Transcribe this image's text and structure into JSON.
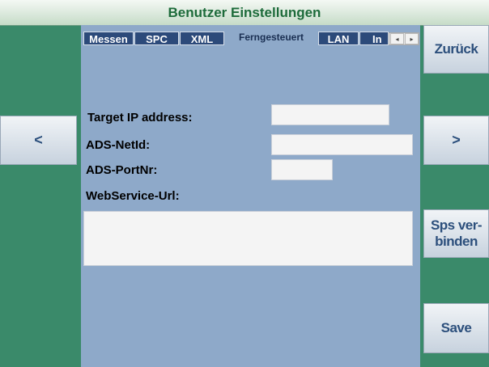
{
  "window": {
    "title": "Benutzer Einstellungen"
  },
  "tabs": [
    {
      "label": "Messen"
    },
    {
      "label": "SPC"
    },
    {
      "label": "XML"
    },
    {
      "label": "Ferngesteuert",
      "active": true
    },
    {
      "label": "LAN"
    },
    {
      "label": "In"
    }
  ],
  "tab_scroll": {
    "left": "◂",
    "right": "▸"
  },
  "form": {
    "target_ip_label": "Target IP address:",
    "target_ip_value": "",
    "ads_netid_label": "ADS-NetId:",
    "ads_netid_value": "",
    "ads_portnr_label": "ADS-PortNr:",
    "ads_portnr_value": "",
    "webservice_url_label": "WebService-Url:",
    "webservice_url_value": ""
  },
  "buttons": {
    "prev": "<",
    "next": ">",
    "back": "Zurück",
    "connect_line1": "Sps ver-",
    "connect_line2": "binden",
    "save": "Save"
  },
  "colors": {
    "background": "#3a8a6a",
    "panel": "#8ea9c9",
    "tab_inactive": "#2c4a7a",
    "title_text": "#1d6b3a",
    "button_text": "#2c4f7c"
  }
}
